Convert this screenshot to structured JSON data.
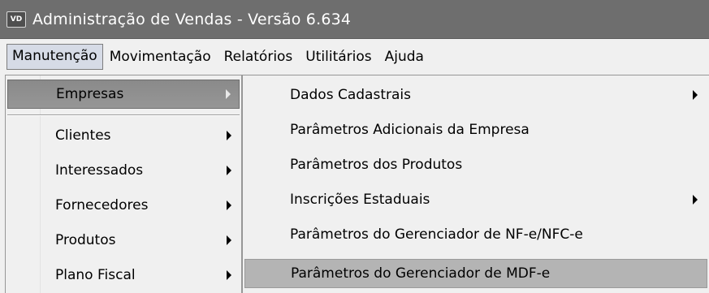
{
  "window": {
    "icon_text": "VD",
    "title": "Administração de Vendas - Versão 6.634"
  },
  "menubar": {
    "items": [
      {
        "label": "Manutenção"
      },
      {
        "label": "Movimentação"
      },
      {
        "label": "Relatórios"
      },
      {
        "label": "Utilitários"
      },
      {
        "label": "Ajuda"
      }
    ]
  },
  "menu_manutencao": {
    "items": [
      {
        "label": "Empresas",
        "submenu": true,
        "highlighted": true
      },
      {
        "label": "Clientes",
        "submenu": true
      },
      {
        "label": "Interessados",
        "submenu": true
      },
      {
        "label": "Fornecedores",
        "submenu": true
      },
      {
        "label": "Produtos",
        "submenu": true
      },
      {
        "label": "Plano Fiscal",
        "submenu": true
      }
    ]
  },
  "menu_empresas": {
    "items": [
      {
        "label": "Dados Cadastrais",
        "submenu": true
      },
      {
        "label": "Parâmetros Adicionais da Empresa",
        "submenu": false
      },
      {
        "label": "Parâmetros dos Produtos",
        "submenu": false
      },
      {
        "label": "Inscrições Estaduais",
        "submenu": true
      },
      {
        "label": "Parâmetros do Gerenciador de NF-e/NFC-e",
        "submenu": false
      },
      {
        "label": "Parâmetros do Gerenciador de MDF-e",
        "submenu": false,
        "highlighted": true
      }
    ]
  },
  "colors": {
    "titlebar": "#6e6e6e",
    "menu_background": "#f0f0f0",
    "highlight_primary": "#8a8a8a",
    "highlight_secondary": "#b4b4b4"
  }
}
